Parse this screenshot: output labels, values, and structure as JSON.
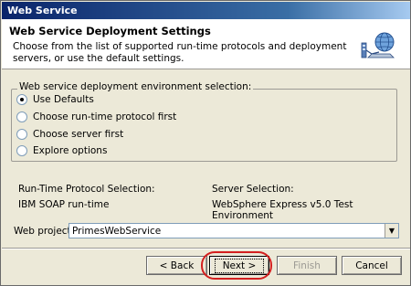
{
  "window": {
    "title": "Web Service"
  },
  "header": {
    "title": "Web Service Deployment Settings",
    "description": "Choose from the list of supported run-time protocols and deployment servers, or use the default settings.",
    "icon": "globe-network-icon"
  },
  "environment": {
    "legend": "Web service deployment environment selection:",
    "options": [
      {
        "label": "Use Defaults",
        "checked": true
      },
      {
        "label": "Choose run-time protocol first",
        "checked": false
      },
      {
        "label": "Choose server first",
        "checked": false
      },
      {
        "label": "Explore options",
        "checked": false
      }
    ]
  },
  "selection": {
    "runtime_label": "Run-Time Protocol Selection:",
    "runtime_value": "IBM SOAP run-time",
    "server_label": "Server Selection:",
    "server_value": "WebSphere Express v5.0 Test Environment"
  },
  "project": {
    "label": "Web project:",
    "value": "PrimesWebService"
  },
  "buttons": {
    "back": "< Back",
    "next": "Next >",
    "finish": "Finish",
    "cancel": "Cancel"
  },
  "colors": {
    "highlight": "#d31f1f",
    "title_bar": "#0a246a"
  }
}
